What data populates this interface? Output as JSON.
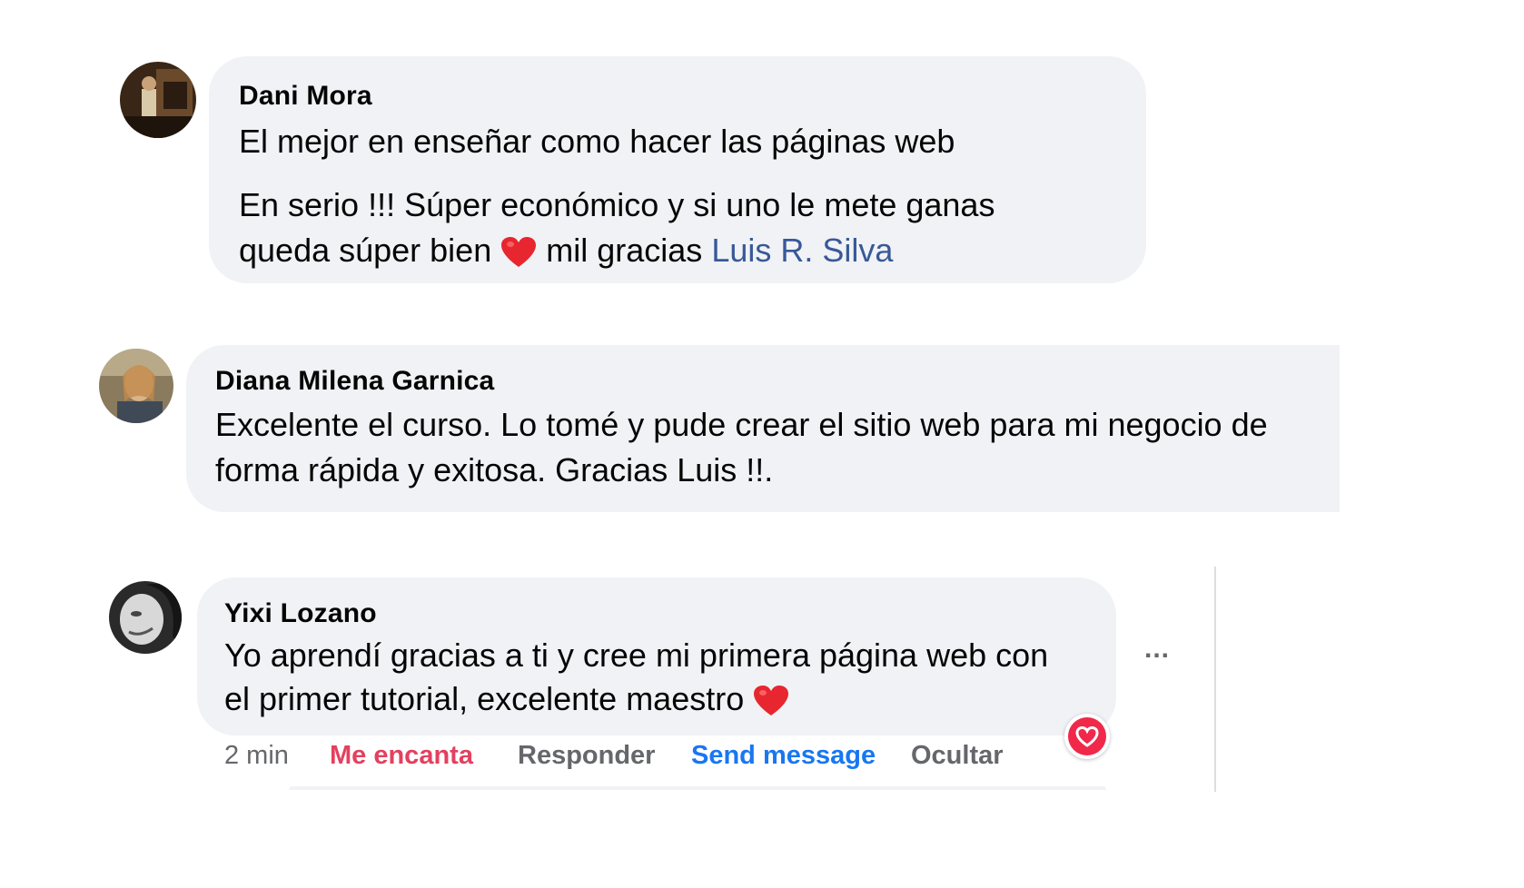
{
  "comments": [
    {
      "author": "Dani Mora",
      "line1": "El mejor en enseñar como hacer las páginas web",
      "line2": "En serio !!! Súper económico y si uno le mete ganas",
      "line3_a": "queda súper bien",
      "line3_b": "mil gracias",
      "mention": "Luis R. Silva",
      "heart_icon": "red-heart-emoji"
    },
    {
      "author": "Diana Milena Garnica",
      "line1": "Excelente el curso. Lo tomé y pude crear el sitio web para mi negocio de",
      "line2": "forma rápida y exitosa. Gracias Luis !!."
    },
    {
      "author": "Yixi Lozano",
      "line1": "Yo aprendí gracias a ti y cree mi primera página web con",
      "line2": "el primer tutorial, excelente maestro",
      "heart_icon": "red-heart-emoji",
      "more_label": "...",
      "actions": {
        "time": "2 min",
        "love": "Me encanta",
        "reply": "Responder",
        "send": "Send message",
        "hide": "Ocultar"
      },
      "reaction_icon": "love-reaction-icon"
    }
  ],
  "colors": {
    "bubble": "#f0f2f5",
    "mention": "#385898",
    "love": "#e4405f",
    "send": "#1877f2",
    "muted": "#65676b"
  }
}
